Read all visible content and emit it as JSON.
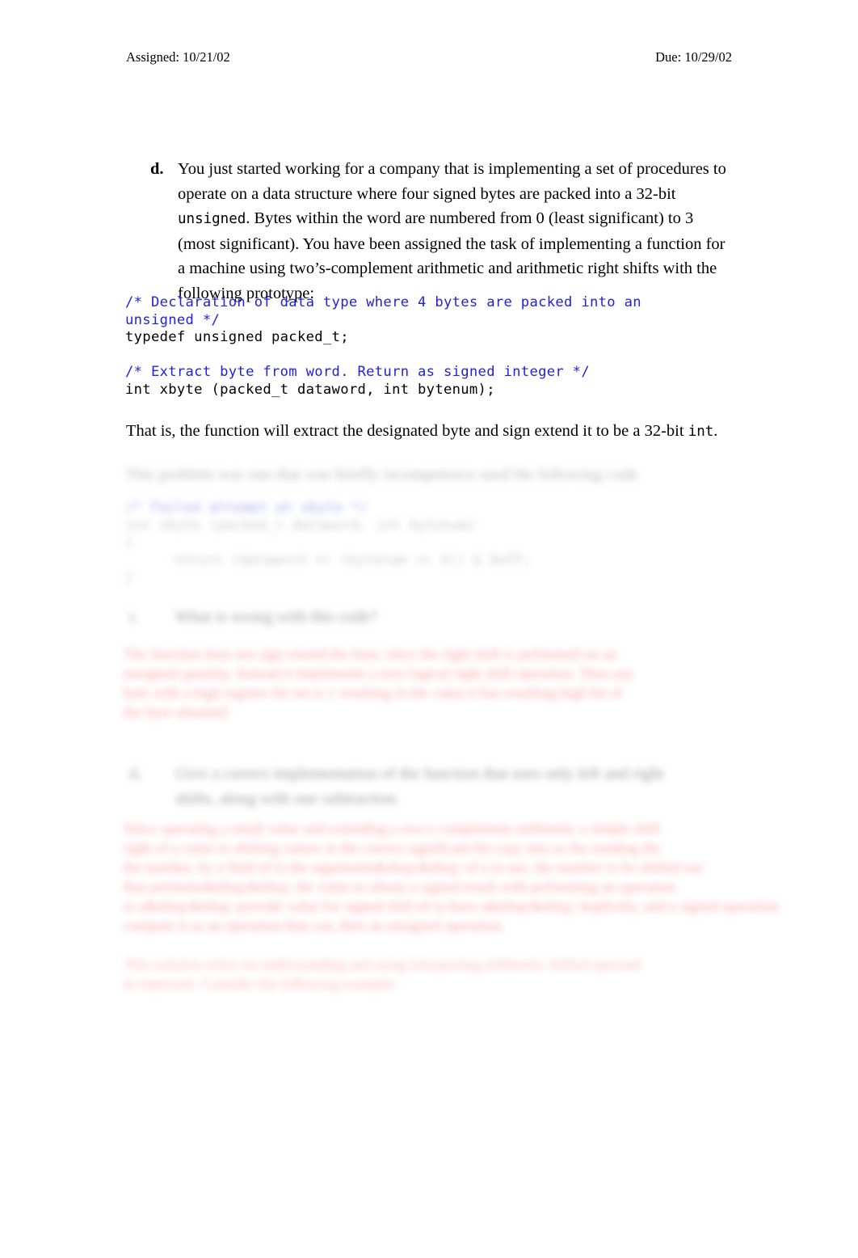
{
  "document": {
    "type": "homework-assignment-page",
    "header": {
      "assigned_label": "Assigned: 10/21/02",
      "due_label": "Due: 10/29/02"
    },
    "question": {
      "marker": "d.",
      "text_part1": "You just started working for a company that is implementing a set of procedures to operate on a data structure where four signed bytes are packed into a 32-bit ",
      "mono1": "unsigned",
      "text_part2": ". Bytes within the word are numbered from 0 (least significant) to 3 (most significant). You have been assigned the task of implementing a function for a machine using two’s-complement arithmetic and arithmetic right shifts with the following prototype:"
    },
    "code_declaration": {
      "line1_comment": "/* Declaration of data type where 4 bytes are packed into an",
      "line2_comment": "unsigned */",
      "line3_source": "typedef unsigned packed_t;",
      "line4_blank": "",
      "line5_comment": "/* Extract byte from word. Return as signed integer */",
      "line6_source": "int xbyte (packed_t dataword, int bytenum);"
    },
    "after_code_text": {
      "part1": "That is, the function will extract the designated byte and sign extend it to be a 32-bit ",
      "mono": "int",
      "part2": "."
    },
    "redacted": {
      "note": "obscured-blurred-answer-content",
      "intro_line": "This problem was one that was briefly incompetence used the following code",
      "code": {
        "comment": "/* Failed attempt at xbyte */",
        "signature": "int xbyte (packed_t dataword, int bytenum)",
        "open_brace": "{",
        "body": "return (dataword >> (bytenum << 3)) & 0xFF;",
        "close_brace": "}"
      },
      "sub_question_i": {
        "marker": "i.",
        "text": "What is wrong with this code?"
      },
      "answer_i": {
        "line1": "The function does not sign extend the byte, since the right shift is performed on an",
        "line2": "unsigned quantity. Instead it implements a zero logical right shift operation. Thus any",
        "line3": "byte with a high register bit set to 1 resulting in the value it has resulting high bit of",
        "line4": "the byte obtained."
      },
      "sub_question_ii": {
        "marker": "ii.",
        "text_line1": "Give a correct implementation of the function that uses only left and right",
        "text_line2": "shifts, along with one subtraction."
      },
      "answer_ii": {
        "line1": "Since operating a small value and extending a two’s complement arithmetic a simple shift",
        "line2": "right of a value to shifting values in the correct significant bit copy into as the sending the",
        "line3": "the number, by a field of to the arguments&nbsp;&nbsp; of a to use, the number to be shifted out",
        "line4": "that performs&nbsp;&nbsp; the value to obtain a signed result with performing an operation",
        "line5": "to a&nbsp;&nbsp; provide value for signed shift of to have a&nbsp;&nbsp; implicitly, and a signed operation",
        "line6": "compute it as an operation that can, then an unsigned operation."
      },
      "answer_iii": {
        "line1": "This solution relies on understanding and using interpreting arithmetic shifted operand",
        "line2": "to represent. Consider the following example:"
      }
    }
  }
}
